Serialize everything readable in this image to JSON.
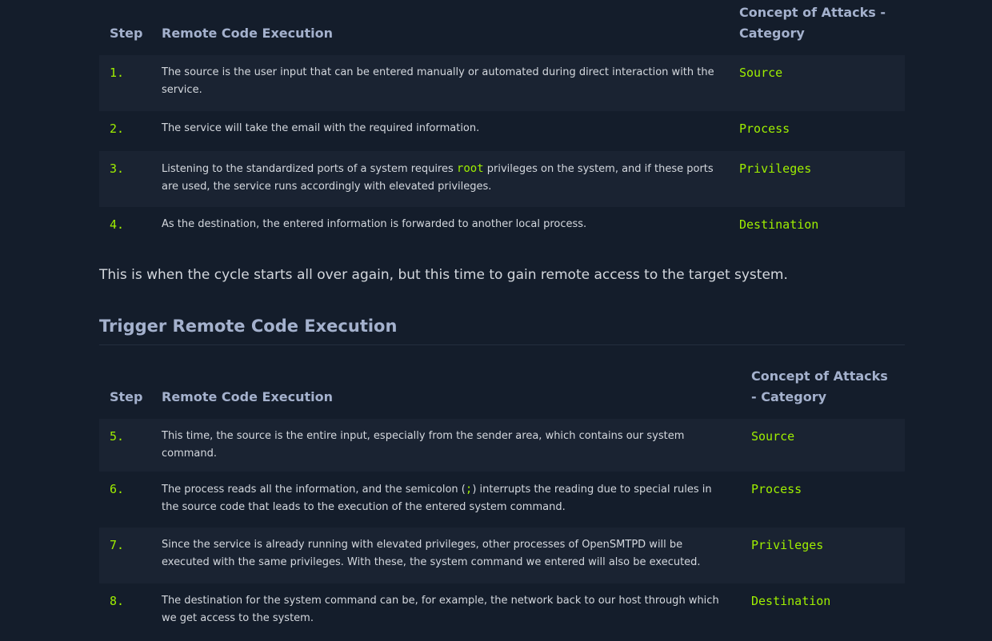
{
  "table1": {
    "headers": [
      "Step",
      "Remote Code Execution",
      "Concept of Attacks - Category"
    ],
    "rows": [
      {
        "step": "1.",
        "desc": "The source is the user input that can be entered manually or automated during direct interaction with the service.",
        "category": "Source"
      },
      {
        "step": "2.",
        "desc": "The service will take the email with the required information.",
        "category": "Process"
      },
      {
        "step": "3.",
        "desc_before": "Listening to the standardized ports of a system requires ",
        "desc_code": "root",
        "desc_after": " privileges on the system, and if these ports are used, the service runs accordingly with elevated privileges.",
        "category": "Privileges"
      },
      {
        "step": "4.",
        "desc": "As the destination, the entered information is forwarded to another local process.",
        "category": "Destination"
      }
    ]
  },
  "paragraph": "This is when the cycle starts all over again, but this time to gain remote access to the target system.",
  "heading": "Trigger Remote Code Execution",
  "table2": {
    "headers": [
      "Step",
      "Remote Code Execution",
      "Concept of Attacks - Category"
    ],
    "rows": [
      {
        "step": "5.",
        "desc": "This time, the source is the entire input, especially from the sender area, which contains our system command.",
        "category": "Source"
      },
      {
        "step": "6.",
        "desc_before": "The process reads all the information, and the semicolon (",
        "desc_code": ";",
        "desc_after": ") interrupts the reading due to special rules in the source code that leads to the execution of the entered system command.",
        "category": "Process"
      },
      {
        "step": "7.",
        "desc": "Since the service is already running with elevated privileges, other processes of OpenSMTPD will be executed with the same privileges. With these, the system command we entered will also be executed.",
        "category": "Privileges"
      },
      {
        "step": "8.",
        "desc": "The destination for the system command can be, for example, the network back to our host through which we get access to the system.",
        "category": "Destination"
      }
    ]
  },
  "colors": {
    "background": "#141d2b",
    "row_alt": "#1a2332",
    "accent_green": "#9fef00",
    "header_text": "#a4b1cd",
    "body_text": "#d4d8de"
  }
}
